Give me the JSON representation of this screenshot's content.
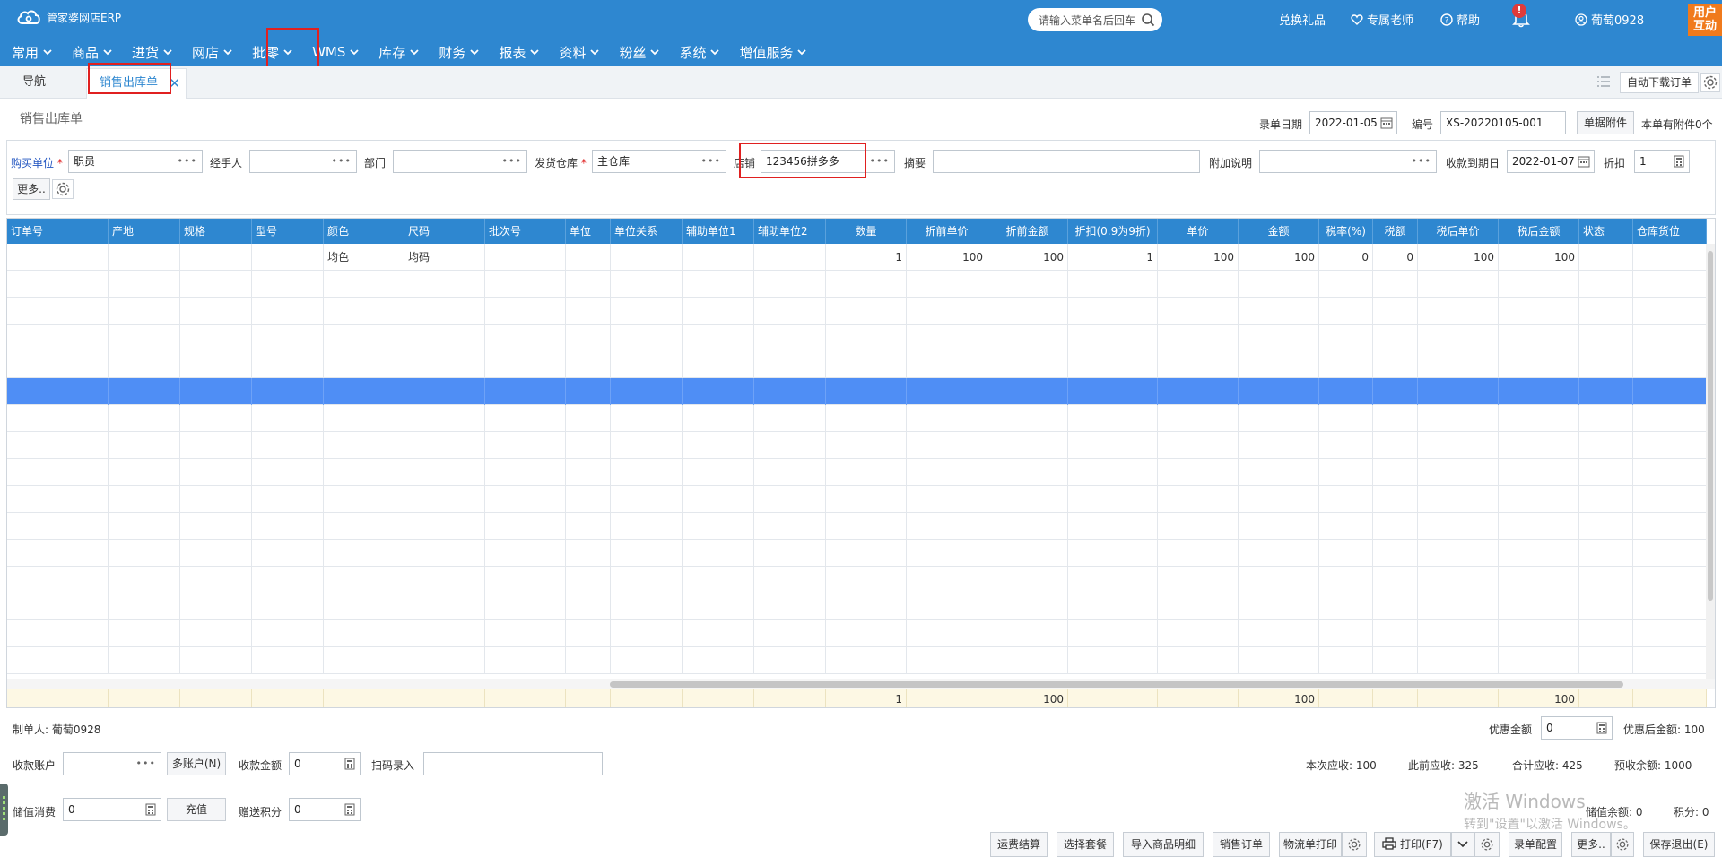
{
  "app": {
    "logo_text": "管家婆网店ERP"
  },
  "header": {
    "search_placeholder": "请输入菜单名后回车",
    "gift": "兑换礼品",
    "teacher": "专属老师",
    "help": "帮助",
    "bell_badge": "!",
    "username": "葡萄0928",
    "user_help_line1": "用户",
    "user_help_line2": "互动"
  },
  "menu": [
    "常用",
    "商品",
    "进货",
    "网店",
    "批零",
    "WMS",
    "库存",
    "财务",
    "报表",
    "资料",
    "粉丝",
    "系统",
    "增值服务"
  ],
  "tabs": {
    "nav": "导航",
    "active": "销售出库单",
    "close": "✕",
    "auto_download": "自动下载订单"
  },
  "doc": {
    "title": "销售出库单",
    "date_label": "录单日期",
    "date": "2022-01-05",
    "no_label": "编号",
    "no": "XS-20220105-001",
    "attach_btn": "单据附件",
    "attach_info": "本单有附件0个"
  },
  "form": {
    "buyer_label": "购买单位",
    "buyer": "职员",
    "handler_label": "经手人",
    "handler": "",
    "dept_label": "部门",
    "dept": "",
    "warehouse_label": "发货仓库",
    "warehouse": "主仓库",
    "store_label": "店铺",
    "store": "123456拼多多",
    "summary_label": "摘要",
    "summary": "",
    "extra_label": "附加说明",
    "extra": "",
    "due_label": "收款到期日",
    "due": "2022-01-07",
    "discount_label": "折扣",
    "discount": "1",
    "more_btn": "更多..",
    "req": "*",
    "dots": "•••"
  },
  "grid": {
    "columns": [
      "订单号",
      "产地",
      "规格",
      "型号",
      "颜色",
      "尺码",
      "批次号",
      "单位",
      "单位关系",
      "辅助单位1",
      "辅助单位2",
      "数量",
      "折前单价",
      "折前金额",
      "折扣(0.9为9折)",
      "单价",
      "金额",
      "税率(%)",
      "税额",
      "税后单价",
      "税后金额",
      "状态",
      "仓库货位"
    ],
    "row1": {
      "color": "均色",
      "size": "均码",
      "qty": "1",
      "pre_price": "100",
      "pre_amount": "100",
      "discount": "1",
      "price": "100",
      "amount": "100",
      "tax_rate": "0",
      "tax": "0",
      "after_price": "100",
      "after_amount": "100"
    },
    "totals": {
      "qty": "1",
      "pre_amount": "100",
      "amount": "100",
      "after_amount": "100"
    }
  },
  "bottom": {
    "maker_label": "制单人:",
    "maker": "葡萄0928",
    "promo_label": "优惠金额",
    "promo": "0",
    "after_promo_label": "优惠后金额:",
    "after_promo": "100",
    "account_label": "收款账户",
    "account": "",
    "multi_account_btn": "多账户(N)",
    "receive_label": "收款金额",
    "receive": "0",
    "scan_label": "扫码录入",
    "scan": "",
    "due_now_label": "本次应收:",
    "due_now": "100",
    "due_before_label": "此前应收:",
    "due_before": "325",
    "due_total_label": "合计应收:",
    "due_total": "425",
    "prepaid_label": "预收余额:",
    "prepaid": "1000",
    "stored_label": "储值消费",
    "stored": "0",
    "recharge_btn": "充值",
    "points_label": "赠送积分",
    "points": "0",
    "stored_balance_label": "储值余额:",
    "stored_balance": "0",
    "score_label": "积分:",
    "score": "0"
  },
  "watermark": {
    "line1": "激活 Windows",
    "line2": "转到\"设置\"以激活 Windows。"
  },
  "footer_buttons": {
    "freight": "运费结算",
    "package": "选择套餐",
    "import": "导入商品明细",
    "sales_order": "销售订单",
    "logistics_print": "物流单打印",
    "print": "打印(F7)",
    "config": "录单配置",
    "more": "更多..",
    "save_exit": "保存退出(E)"
  },
  "colors": {
    "header_bg": "#2e87d0",
    "selected_row": "#4f8ef5",
    "highlight_box": "#e02020",
    "user_help_bg": "#f07a1c"
  }
}
